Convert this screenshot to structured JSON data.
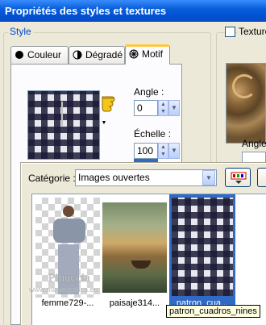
{
  "window": {
    "title": "Propriétés des styles et textures"
  },
  "style_group": {
    "label": "Style"
  },
  "tabs": [
    {
      "label": "Couleur",
      "icon": "color-dot-icon"
    },
    {
      "label": "Dégradé",
      "icon": "gradient-icon"
    },
    {
      "label": "Motif",
      "icon": "pattern-icon"
    }
  ],
  "texture": {
    "checkbox_label": "Texture",
    "checked": false,
    "angle_label": "Angle"
  },
  "pattern": {
    "angle_label": "Angle :",
    "angle_value": "0",
    "scale_label": "Échelle :",
    "scale_value": "100"
  },
  "picker": {
    "category_label": "Catégorie :",
    "category_value": "Images ouvertes",
    "thumbnails": [
      {
        "caption": "femme729-...",
        "watermark_main": "Pinuccia",
        "watermark_sub": "www.magiegrafica.eu"
      },
      {
        "caption": "paisaje314..."
      },
      {
        "caption": "patron_cua...",
        "selected": true
      }
    ],
    "tooltip": "patron_cuadros_nines"
  },
  "colors": {
    "accent": "#316ac5",
    "title_bar": "#0054e3",
    "group_label": "#0046d5"
  }
}
